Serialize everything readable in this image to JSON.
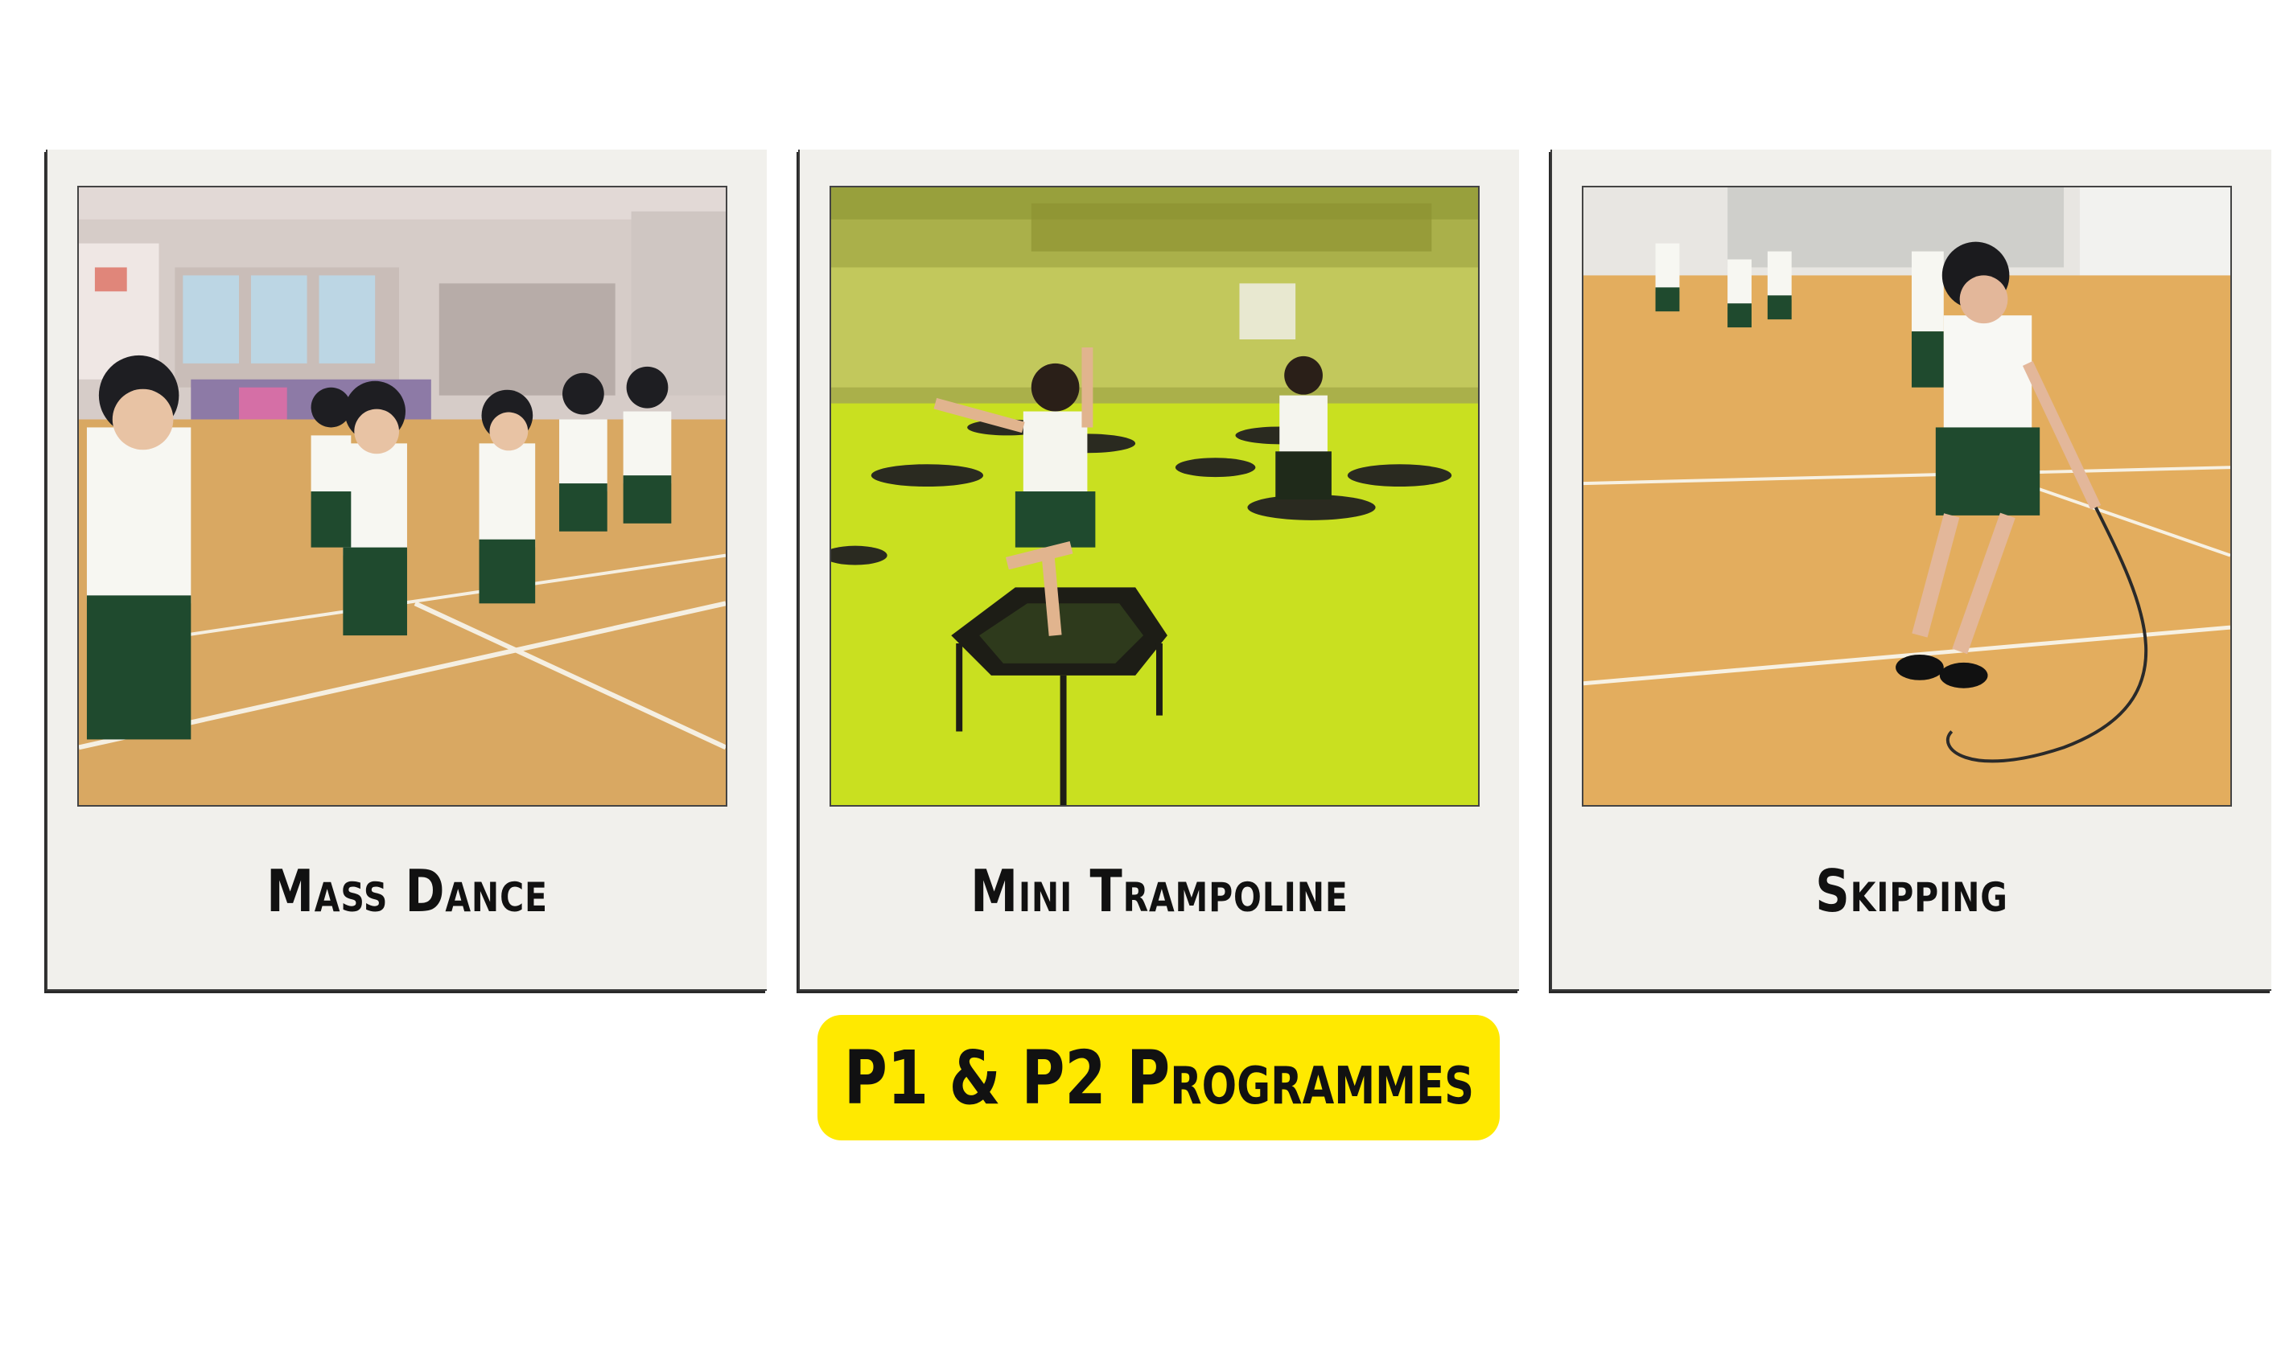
{
  "cards": [
    {
      "caption": "Mass Dance",
      "photo_icon": "students-dancing-photo"
    },
    {
      "caption": "Mini Trampoline",
      "photo_icon": "students-trampoline-photo"
    },
    {
      "caption": "Skipping",
      "photo_icon": "students-skipping-photo"
    }
  ],
  "banner": {
    "title": "P1 & P2 Programmes"
  },
  "colors": {
    "card_bg": "#f1f0ec",
    "banner_bg": "#ffe900",
    "floor_wood": "#d9a862",
    "uniform_green": "#1f4a2e",
    "trampoline_tint": "#c9e020"
  }
}
